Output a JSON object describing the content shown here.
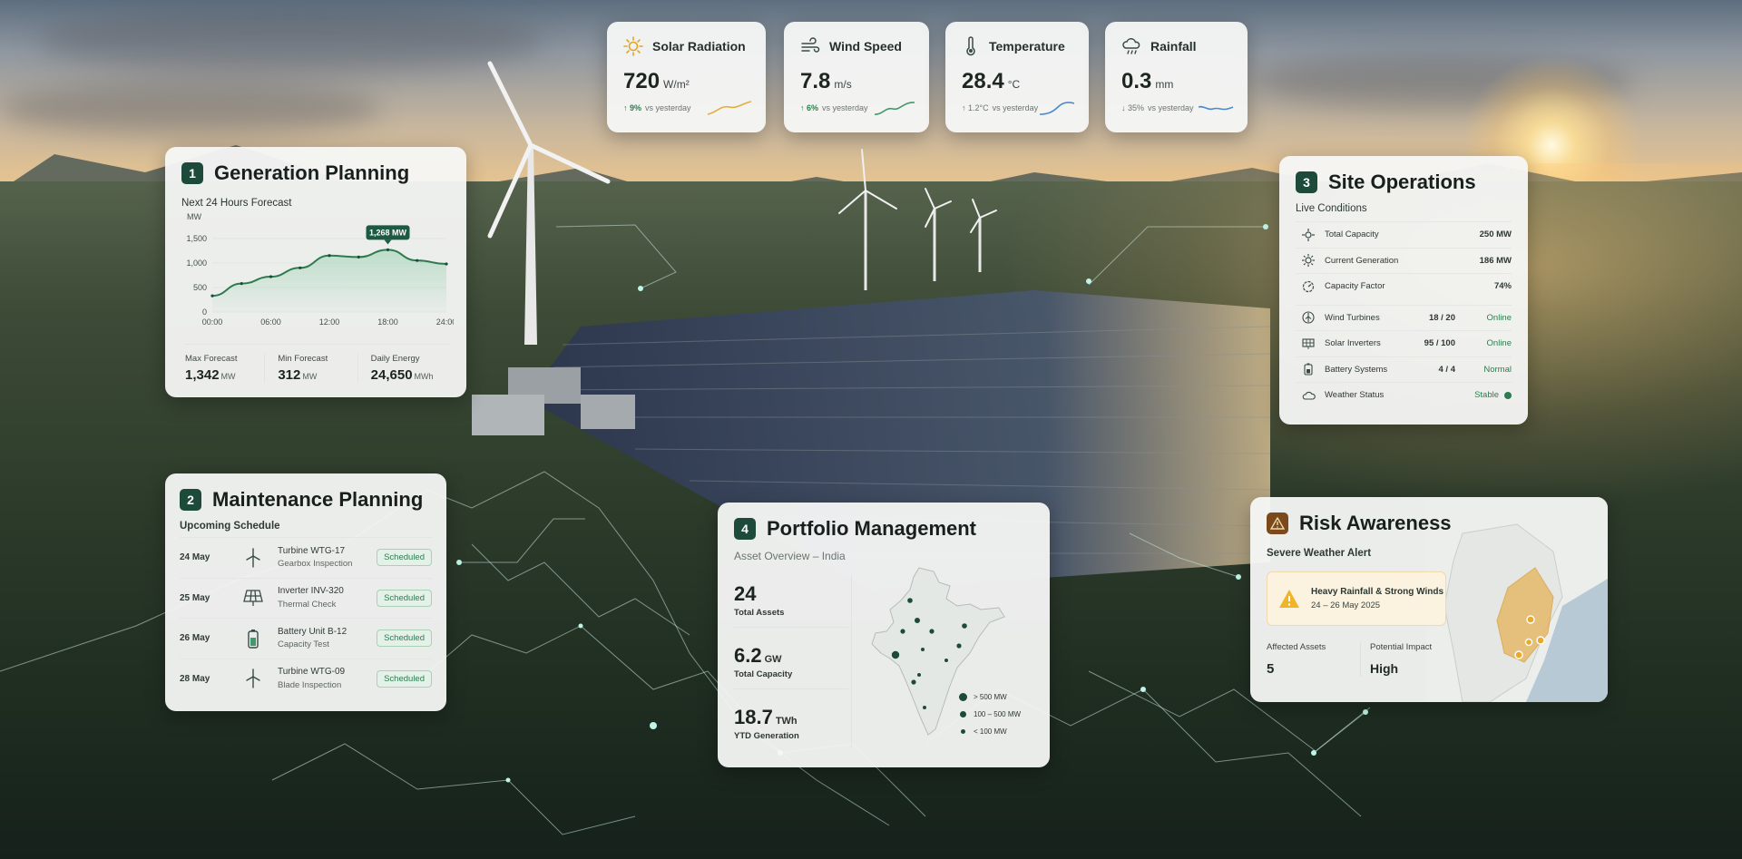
{
  "weather": [
    {
      "title": "Solar Radiation",
      "value": "720",
      "unit": "W/m²",
      "trend": "↑ 9%",
      "trend_label": "vs yesterday",
      "icon": "sun-icon"
    },
    {
      "title": "Wind Speed",
      "value": "7.8",
      "unit": "m/s",
      "trend": "↑ 6%",
      "trend_label": "vs yesterday",
      "icon": "wind-icon"
    },
    {
      "title": "Temperature",
      "value": "28.4",
      "unit": "°C",
      "trend": "↑ 1.2°C",
      "trend_label": "vs yesterday",
      "icon": "thermometer-icon"
    },
    {
      "title": "Rainfall",
      "value": "0.3",
      "unit": "mm",
      "trend": "↓ 35%",
      "trend_label": "vs yesterday",
      "icon": "rain-cloud-icon"
    }
  ],
  "generation": {
    "number": "1",
    "title": "Generation Planning",
    "subtitle": "Next 24 Hours Forecast",
    "peak_label": "1,268 MW",
    "stats": [
      {
        "label": "Max Forecast",
        "value": "1,342",
        "unit": "MW"
      },
      {
        "label": "Min Forecast",
        "value": "312",
        "unit": "MW"
      },
      {
        "label": "Daily Energy",
        "value": "24,650",
        "unit": "MWh"
      }
    ]
  },
  "chart_data": {
    "type": "area",
    "title": "Next 24 Hours Forecast",
    "xlabel": "",
    "ylabel": "MW",
    "x": [
      "00:00",
      "03:00",
      "06:00",
      "09:00",
      "12:00",
      "15:00",
      "18:00",
      "21:00",
      "24:00"
    ],
    "xticks": [
      "00:00",
      "06:00",
      "12:00",
      "18:00",
      "24:00"
    ],
    "yticks": [
      "0",
      "500",
      "1,000",
      "1,500"
    ],
    "ylim": [
      0,
      1700
    ],
    "values": [
      330,
      580,
      720,
      900,
      1150,
      1120,
      1268,
      1050,
      980
    ],
    "annotation": "1,268 MW",
    "grid": true
  },
  "maintenance": {
    "number": "2",
    "title": "Maintenance Planning",
    "subtitle": "Upcoming Schedule",
    "items": [
      {
        "date": "24 May",
        "asset": "Turbine WTG-17",
        "task": "Gearbox Inspection",
        "status": "Scheduled",
        "icon": "wind-turbine-icon"
      },
      {
        "date": "25 May",
        "asset": "Inverter INV-320",
        "task": "Thermal Check",
        "status": "Scheduled",
        "icon": "solar-panel-icon"
      },
      {
        "date": "26 May",
        "asset": "Battery Unit B-12",
        "task": "Capacity Test",
        "status": "Scheduled",
        "icon": "battery-icon"
      },
      {
        "date": "28 May",
        "asset": "Turbine WTG-09",
        "task": "Blade Inspection",
        "status": "Scheduled",
        "icon": "wind-turbine-icon"
      }
    ]
  },
  "site": {
    "number": "3",
    "title": "Site Operations",
    "subtitle": "Live Conditions",
    "metrics": [
      {
        "label": "Total Capacity",
        "value": "250 MW",
        "icon": "capacity-icon"
      },
      {
        "label": "Current Generation",
        "value": "186 MW",
        "icon": "sun-generation-icon"
      },
      {
        "label": "Capacity Factor",
        "value": "74%",
        "icon": "gauge-icon"
      }
    ],
    "systems": [
      {
        "label": "Wind Turbines",
        "count": "18 / 20",
        "status": "Online",
        "icon": "turbine-circle-icon"
      },
      {
        "label": "Solar Inverters",
        "count": "95 / 100",
        "status": "Online",
        "icon": "inverter-icon"
      },
      {
        "label": "Battery Systems",
        "count": "4 / 4",
        "status": "Normal",
        "icon": "battery-icon"
      }
    ],
    "weather_status": {
      "label": "Weather Status",
      "status": "Stable",
      "icon": "cloud-icon"
    },
    "accent": "#2e7b4f"
  },
  "portfolio": {
    "number": "4",
    "title": "Portfolio Management",
    "subtitle": "Asset Overview – India",
    "stats": [
      {
        "value": "24",
        "unit": "",
        "label": "Total Assets"
      },
      {
        "value": "6.2",
        "unit": "GW",
        "label": "Total Capacity"
      },
      {
        "value": "18.7",
        "unit": "TWh",
        "label": "YTD Generation"
      }
    ],
    "legend": [
      "> 500 MW",
      "100 – 500 MW",
      "< 100 MW"
    ]
  },
  "risk": {
    "title": "Risk Awareness",
    "subtitle": "Severe Weather Alert",
    "alert_title": "Heavy Rainfall & Strong Winds",
    "alert_dates": "24 – 26 May 2025",
    "affected_label": "Affected Assets",
    "affected_value": "5",
    "impact_label": "Potential Impact",
    "impact_value": "High",
    "accent": "#c9801a"
  },
  "colors": {
    "brand": "#1d4a3a",
    "online": "#2e7b4f",
    "warning": "#e0a125"
  }
}
